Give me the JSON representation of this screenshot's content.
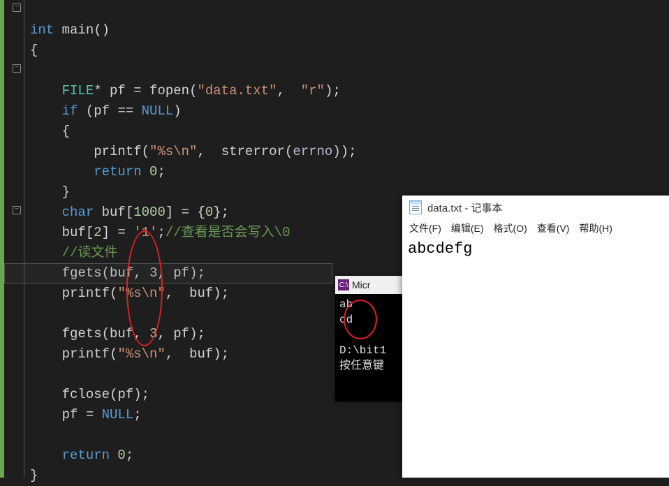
{
  "code": {
    "l1_int": "int",
    "l1_main": " main",
    "l1_paren": "()",
    "l2_brace": "{",
    "l3_type": "    FILE",
    "l3_star": "* ",
    "l3_pf": "pf",
    "l3_eq": " = ",
    "l3_fopen": "fopen",
    "l3_p1": "(",
    "l3_str1": "\"data.txt\"",
    "l3_comma": ",  ",
    "l3_str2": "\"r\"",
    "l3_p2": ");",
    "l4_if": "    if ",
    "l4_p1": "(",
    "l4_pf": "pf",
    "l4_eq": " == ",
    "l4_null": "NULL",
    "l4_p2": ")",
    "l5_brace": "    {",
    "l6_printf": "        printf",
    "l6_p1": "(",
    "l6_str": "\"%s\\n\"",
    "l6_comma": ",  ",
    "l6_strerror": "strerror",
    "l6_p2": "(",
    "l6_errno": "errno",
    "l6_p3": "));",
    "l7_return": "        return ",
    "l7_zero": "0",
    "l7_semi": ";",
    "l8_brace": "    }",
    "l9_char": "    char ",
    "l9_buf": "buf",
    "l9_br": "[",
    "l9_num": "1000",
    "l9_br2": "] = {",
    "l9_zero": "0",
    "l9_end": "};",
    "l10_buf": "    buf",
    "l10_br": "[",
    "l10_two": "2",
    "l10_br2": "] = ",
    "l10_ch": "'1'",
    "l10_semi": ";",
    "l10_comment": "//查看是否会写入\\0",
    "l11_comment": "    //读文件",
    "l12_fgets": "    fgets",
    "l12_p1": "(",
    "l12_buf": "buf",
    "l12_c1": ", ",
    "l12_three": "3",
    "l12_c2": ", ",
    "l12_pf": "pf",
    "l12_p2": ");",
    "l13_printf": "    printf",
    "l13_p1": "(",
    "l13_str": "\"%s\\n\"",
    "l13_c": ",  ",
    "l13_buf": "buf",
    "l13_p2": ");",
    "l15_fgets": "    fgets",
    "l15_p1": "(",
    "l15_buf": "buf",
    "l15_c1": ", ",
    "l15_three": "3",
    "l15_c2": ", ",
    "l15_pf": "pf",
    "l15_p2": ");",
    "l16_printf": "    printf",
    "l16_p1": "(",
    "l16_str": "\"%s\\n\"",
    "l16_c": ",  ",
    "l16_buf": "buf",
    "l16_p2": ");",
    "l18_fclose": "    fclose",
    "l18_p1": "(",
    "l18_pf": "pf",
    "l18_p2": ");",
    "l19_pf": "    pf",
    "l19_eq": " = ",
    "l19_null": "NULL",
    "l19_semi": ";",
    "l21_return": "    return ",
    "l21_zero": "0",
    "l21_semi": ";",
    "l22_brace": "}"
  },
  "console": {
    "title_prefix": "Micr",
    "icon_text": "C:\\",
    "out1": "ab",
    "out2": "cd",
    "blank": "",
    "path": "D:\\bit1",
    "press": "按任意键"
  },
  "notepad": {
    "title": "data.txt - 记事本",
    "menu": {
      "file": "文件(F)",
      "edit": "编辑(E)",
      "format": "格式(O)",
      "view": "查看(V)",
      "help": "帮助(H)"
    },
    "content": "abcdefg"
  }
}
